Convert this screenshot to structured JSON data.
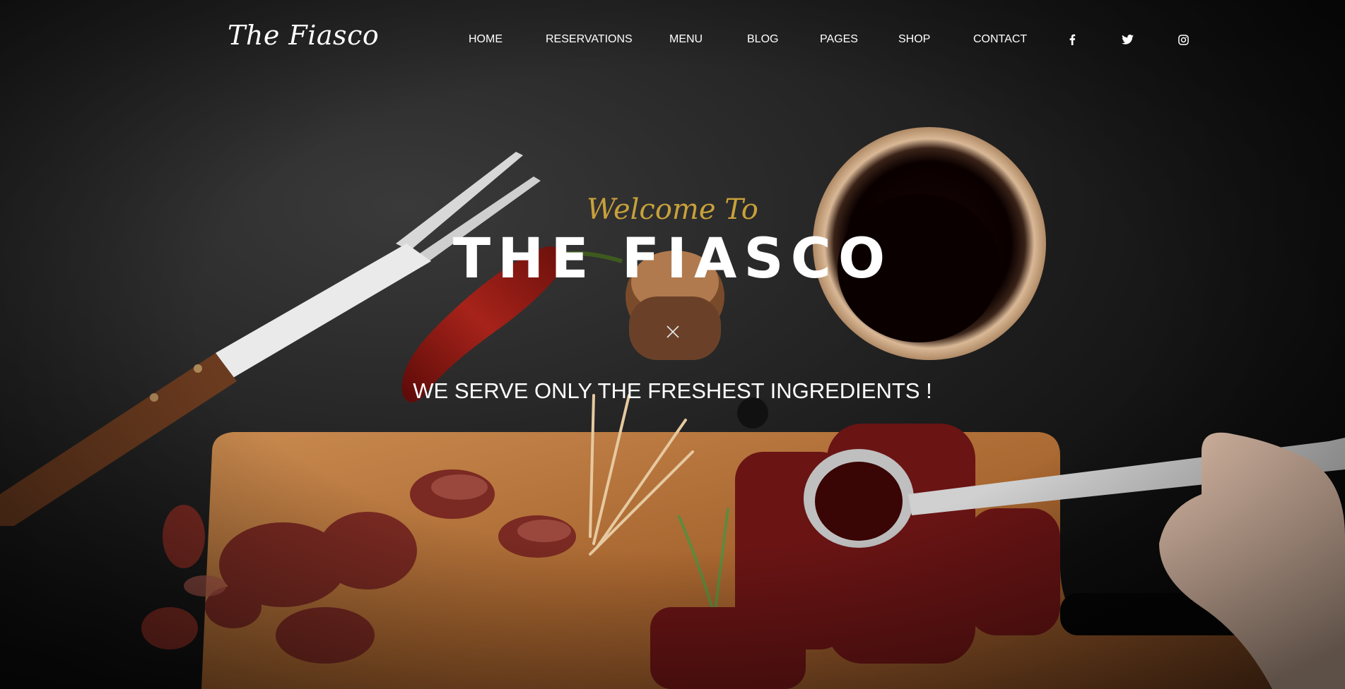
{
  "header": {
    "logo": "The Fiasco",
    "nav": [
      {
        "label": "HOME"
      },
      {
        "label": "RESERVATIONS"
      },
      {
        "label": "MENU"
      },
      {
        "label": "BLOG"
      },
      {
        "label": "PAGES"
      },
      {
        "label": "SHOP"
      },
      {
        "label": "CONTACT"
      }
    ],
    "social": [
      {
        "icon": "facebook-icon"
      },
      {
        "icon": "twitter-icon"
      },
      {
        "icon": "instagram-icon"
      }
    ]
  },
  "hero": {
    "welcome": "Welcome To",
    "title": "THE FIASCO",
    "divider_icon": "fork-knife-icon",
    "tagline": "WE SERVE ONLY THE FRESHEST INGREDIENTS !"
  },
  "colors": {
    "accent": "#c8a13a",
    "text": "#ffffff",
    "background": "#000000"
  }
}
